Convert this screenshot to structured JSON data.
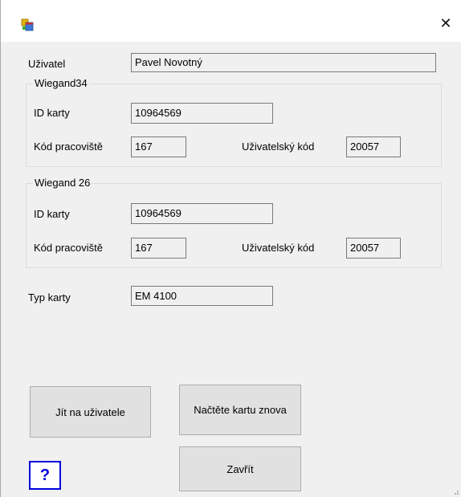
{
  "window": {
    "icon": "app-window-icon",
    "close_glyph": "✕"
  },
  "user": {
    "label": "Uživatel",
    "value": "Pavel Novotný"
  },
  "wiegand34": {
    "title": "Wiegand34",
    "card_id_label": "ID karty",
    "card_id_value": "10964569",
    "site_code_label": "Kód pracoviště",
    "site_code_value": "167",
    "user_code_label": "Uživatelský kód",
    "user_code_value": "20057"
  },
  "wiegand26": {
    "title": "Wiegand 26",
    "card_id_label": "ID karty",
    "card_id_value": "10964569",
    "site_code_label": "Kód pracoviště",
    "site_code_value": "167",
    "user_code_label": "Uživatelský kód",
    "user_code_value": "20057"
  },
  "card_type": {
    "label": "Typ karty",
    "value": "EM 4100"
  },
  "buttons": {
    "go_to_user": "Jít na uživatele",
    "read_again": "Načtěte kartu znova",
    "close": "Zavřít",
    "help": "?"
  },
  "colors": {
    "window_bg": "#f0f0f0",
    "help_accent": "#0000e0"
  }
}
